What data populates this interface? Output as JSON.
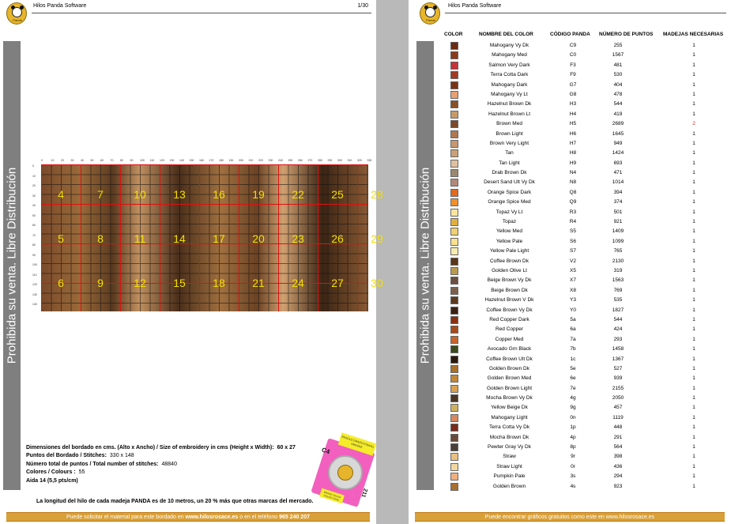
{
  "left": {
    "header_title": "Hilos Panda Software",
    "page_number": "1/30",
    "logo_text": "Panda",
    "side_text": "Prohibida su venta. Libre Distribución",
    "ruler_top": [
      "0",
      "10",
      "20",
      "30",
      "40",
      "50",
      "60",
      "70",
      "80",
      "90",
      "100",
      "110",
      "120",
      "130",
      "140",
      "150",
      "160",
      "170",
      "180",
      "190",
      "200",
      "210",
      "220",
      "230",
      "240",
      "250",
      "260",
      "270",
      "280",
      "290",
      "300",
      "310",
      "320",
      "330"
    ],
    "ruler_left": [
      "0",
      "10",
      "20",
      "30",
      "40",
      "50",
      "60",
      "70",
      "80",
      "90",
      "100",
      "110",
      "120",
      "130",
      "140"
    ],
    "page_numbers": [
      "4",
      "7",
      "10",
      "13",
      "16",
      "19",
      "22",
      "25",
      "28",
      "5",
      "8",
      "11",
      "14",
      "17",
      "20",
      "23",
      "26",
      "29",
      "6",
      "9",
      "12",
      "15",
      "18",
      "21",
      "24",
      "27",
      "30"
    ],
    "info": {
      "dimensions_label": "Dimensiones del bordado en cms. (Alto x Ancho) / Size of embroidery in cms (Height x Width):",
      "dimensions_value": "60 x 27",
      "stitches_label": "Puntos del Bordado / Stitches:",
      "stitches_value": "330 x 148",
      "total_label": "Número total de puntos / Total number of stitches:",
      "total_value": "48840",
      "colors_label": "Colores / Colours :",
      "colors_value": "55",
      "aida_label": "Aida 14 (5,5 pts/cm)"
    },
    "note": "La longitud del hilo de cada madeja PANDA es de 10 metros, un 20 % más que otras marcas del mercado.",
    "footer_prefix": "Puede solicitar el material para este bordado en",
    "footer_site": "www.hilosrosace.es",
    "footer_mid": "o en el teléfono",
    "footer_phone": "965 240 207",
    "bobbin": {
      "code_a": "C4",
      "code_b": "211",
      "tag_a": "ENSOLO GRADO ESMALL GRANDE",
      "tag_b": "GRADO COLOR COLOR CODE"
    }
  },
  "right": {
    "header_title": "Hilos Panda Software",
    "logo_text": "Panda",
    "side_text": "Prohibida su venta. Libre Distribución",
    "columns": [
      "COLOR",
      "NOMBRE DEL COLOR",
      "CÓDIGO PANDA",
      "NÚMERO DE PUNTOS",
      "MADEJAS NECESARIAS"
    ],
    "rows": [
      {
        "swatch": "#6b2a12",
        "name": "Mahogany Vy Dk",
        "code": "C9",
        "points": "255",
        "skeins": "1"
      },
      {
        "swatch": "#8a3a1a",
        "name": "Mahogany Med",
        "code": "C0",
        "points": "1567",
        "skeins": "1"
      },
      {
        "swatch": "#c8323a",
        "name": "Salmon Very Dark",
        "code": "F3",
        "points": "481",
        "skeins": "1"
      },
      {
        "swatch": "#a03a24",
        "name": "Terra Cotta Dark",
        "code": "F9",
        "points": "530",
        "skeins": "1"
      },
      {
        "swatch": "#7a3416",
        "name": "Mahogany Dark",
        "code": "G7",
        "points": "404",
        "skeins": "1"
      },
      {
        "swatch": "#e8a070",
        "name": "Mahogany Vy Lt",
        "code": "G8",
        "points": "478",
        "skeins": "1"
      },
      {
        "swatch": "#8a5028",
        "name": "Hazelnut Brown Dk",
        "code": "H3",
        "points": "544",
        "skeins": "1"
      },
      {
        "swatch": "#c89a6a",
        "name": "Hazelnut Brown Lt",
        "code": "H4",
        "points": "419",
        "skeins": "1"
      },
      {
        "swatch": "#7a4a2a",
        "name": "Brown Med",
        "code": "H5",
        "points": "2689",
        "skeins": "2"
      },
      {
        "swatch": "#b07850",
        "name": "Brown Light",
        "code": "H6",
        "points": "1645",
        "skeins": "1"
      },
      {
        "swatch": "#c89870",
        "name": "Brown Very Light",
        "code": "H7",
        "points": "949",
        "skeins": "1"
      },
      {
        "swatch": "#c8a078",
        "name": "Tan",
        "code": "H8",
        "points": "1424",
        "skeins": "1"
      },
      {
        "swatch": "#e0c0a0",
        "name": "Tan Light",
        "code": "H9",
        "points": "693",
        "skeins": "1"
      },
      {
        "swatch": "#9a8870",
        "name": "Drab Brown Dk",
        "code": "N4",
        "points": "471",
        "skeins": "1"
      },
      {
        "swatch": "#b08a78",
        "name": "Desert Sand Ult Vy Dk",
        "code": "N8",
        "points": "1014",
        "skeins": "1"
      },
      {
        "swatch": "#e06a20",
        "name": "Orange Spice Dark",
        "code": "Q8",
        "points": "394",
        "skeins": "1"
      },
      {
        "swatch": "#f0902a",
        "name": "Orange Spice Med",
        "code": "Q9",
        "points": "374",
        "skeins": "1"
      },
      {
        "swatch": "#f8e4a0",
        "name": "Topaz Vy Lt",
        "code": "R3",
        "points": "501",
        "skeins": "1"
      },
      {
        "swatch": "#e0b040",
        "name": "Topaz",
        "code": "R4",
        "points": "921",
        "skeins": "1"
      },
      {
        "swatch": "#f0d070",
        "name": "Yellow Med",
        "code": "S5",
        "points": "1409",
        "skeins": "1"
      },
      {
        "swatch": "#f8e090",
        "name": "Yellow Pale",
        "code": "S6",
        "points": "1099",
        "skeins": "1"
      },
      {
        "swatch": "#f8ecb0",
        "name": "Yellow Pale Light",
        "code": "S7",
        "points": "765",
        "skeins": "1"
      },
      {
        "swatch": "#5a3618",
        "name": "Coffee Brown Dk",
        "code": "V2",
        "points": "2130",
        "skeins": "1"
      },
      {
        "swatch": "#b89a50",
        "name": "Golden Olive Lt",
        "code": "X5",
        "points": "319",
        "skeins": "1"
      },
      {
        "swatch": "#6a5040",
        "name": "Beige Brown Vy Dk",
        "code": "X7",
        "points": "1563",
        "skeins": "1"
      },
      {
        "swatch": "#7a604c",
        "name": "Beige Brown Dk",
        "code": "X8",
        "points": "769",
        "skeins": "1"
      },
      {
        "swatch": "#5a3a20",
        "name": "Hazelnut Brown V Dk",
        "code": "Y3",
        "points": "535",
        "skeins": "1"
      },
      {
        "swatch": "#3a2212",
        "name": "Coffee Brown Vy Dk",
        "code": "Y0",
        "points": "1827",
        "skeins": "1"
      },
      {
        "swatch": "#8a3010",
        "name": "Red Copper Dark",
        "code": "5a",
        "points": "544",
        "skeins": "1"
      },
      {
        "swatch": "#a84a1a",
        "name": "Red Copper",
        "code": "6a",
        "points": "424",
        "skeins": "1"
      },
      {
        "swatch": "#c8642a",
        "name": "Copper Med",
        "code": "7a",
        "points": "293",
        "skeins": "1"
      },
      {
        "swatch": "#3a4a1a",
        "name": "Avocado Grn Black",
        "code": "7b",
        "points": "1458",
        "skeins": "1"
      },
      {
        "swatch": "#2a180c",
        "name": "Coffee Brown Ult Dk",
        "code": "1c",
        "points": "1367",
        "skeins": "1"
      },
      {
        "swatch": "#a8702a",
        "name": "Golden Brown Dk",
        "code": "5e",
        "points": "527",
        "skeins": "1"
      },
      {
        "swatch": "#c08838",
        "name": "Golden Brown Med",
        "code": "6e",
        "points": "939",
        "skeins": "1"
      },
      {
        "swatch": "#d8a050",
        "name": "Golden Brown Light",
        "code": "7e",
        "points": "2155",
        "skeins": "1"
      },
      {
        "swatch": "#4a3424",
        "name": "Mocha Brown Vy Dk",
        "code": "4g",
        "points": "2050",
        "skeins": "1"
      },
      {
        "swatch": "#d0b060",
        "name": "Yellow Beige Dk",
        "code": "9g",
        "points": "457",
        "skeins": "1"
      },
      {
        "swatch": "#d88860",
        "name": "Mahogany Light",
        "code": "0n",
        "points": "1119",
        "skeins": "1"
      },
      {
        "swatch": "#7a2a1a",
        "name": "Terra Cotta Vy Dk",
        "code": "1p",
        "points": "448",
        "skeins": "1"
      },
      {
        "swatch": "#6a4a38",
        "name": "Mocha Brown Dk",
        "code": "4p",
        "points": "291",
        "skeins": "1"
      },
      {
        "swatch": "#4a4038",
        "name": "Pewter Gray Vy Dk",
        "code": "8p",
        "points": "564",
        "skeins": "1"
      },
      {
        "swatch": "#e8c080",
        "name": "Straw",
        "code": "9r",
        "points": "398",
        "skeins": "1"
      },
      {
        "swatch": "#f0d8a0",
        "name": "Straw Light",
        "code": "0r",
        "points": "436",
        "skeins": "1"
      },
      {
        "swatch": "#f0b080",
        "name": "Pumpkin Pale",
        "code": "3s",
        "points": "294",
        "skeins": "1"
      },
      {
        "swatch": "#a87030",
        "name": "Golden Brown",
        "code": "4s",
        "points": "923",
        "skeins": "1"
      }
    ],
    "footer": "Puede encontrar gráficos gratuitos como este en www.hilosrosace.es"
  }
}
